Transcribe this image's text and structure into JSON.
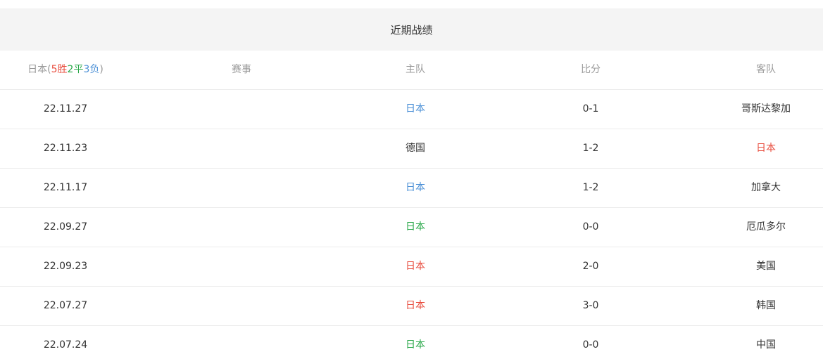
{
  "title": "近期战绩",
  "header": {
    "team": "日本",
    "paren_open": "(",
    "wins": "5胜",
    "draws": "2平",
    "losses": "3负",
    "paren_close": ")",
    "competition": "赛事",
    "home": "主队",
    "score": "比分",
    "away": "客队"
  },
  "colors": {
    "win": "#e84c3d",
    "draw": "#2aa84a",
    "loss": "#4a8fd6",
    "text": "#333333",
    "muted": "#999999",
    "title_bg": "#f4f4f4"
  },
  "matches": [
    {
      "date": "22.11.27",
      "competition": "",
      "home": "日本",
      "home_style": "loss",
      "score": "0-1",
      "away": "哥斯达黎加",
      "away_style": "dark"
    },
    {
      "date": "22.11.23",
      "competition": "",
      "home": "德国",
      "home_style": "dark",
      "score": "1-2",
      "away": "日本",
      "away_style": "win"
    },
    {
      "date": "22.11.17",
      "competition": "",
      "home": "日本",
      "home_style": "loss",
      "score": "1-2",
      "away": "加拿大",
      "away_style": "dark"
    },
    {
      "date": "22.09.27",
      "competition": "",
      "home": "日本",
      "home_style": "draw",
      "score": "0-0",
      "away": "厄瓜多尔",
      "away_style": "dark"
    },
    {
      "date": "22.09.23",
      "competition": "",
      "home": "日本",
      "home_style": "win",
      "score": "2-0",
      "away": "美国",
      "away_style": "dark"
    },
    {
      "date": "22.07.27",
      "competition": "",
      "home": "日本",
      "home_style": "win",
      "score": "3-0",
      "away": "韩国",
      "away_style": "dark"
    },
    {
      "date": "22.07.24",
      "competition": "",
      "home": "日本",
      "home_style": "draw",
      "score": "0-0",
      "away": "中国",
      "away_style": "dark"
    }
  ]
}
